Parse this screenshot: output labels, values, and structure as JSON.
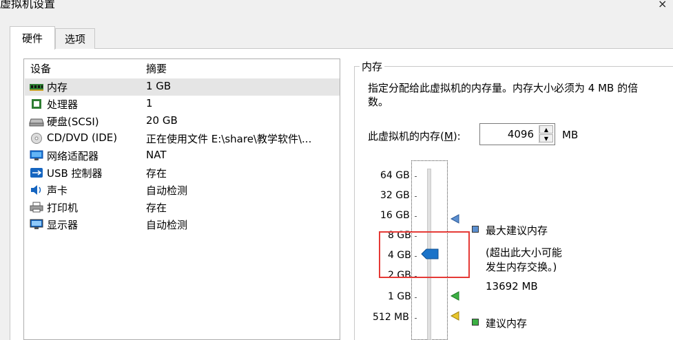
{
  "window": {
    "title": "虚拟机设置",
    "close_glyph": "×"
  },
  "tabs": [
    {
      "label": "硬件"
    },
    {
      "label": "选项"
    }
  ],
  "device_list": {
    "header_device": "设备",
    "header_summary": "摘要",
    "rows": [
      {
        "name": "内存",
        "summary": "1 GB",
        "icon": "memory-icon",
        "selected": true
      },
      {
        "name": "处理器",
        "summary": "1",
        "icon": "processor-icon"
      },
      {
        "name": "硬盘(SCSI)",
        "summary": "20 GB",
        "icon": "hard-disk-icon"
      },
      {
        "name": "CD/DVD (IDE)",
        "summary": "正在使用文件 E:\\share\\教学软件\\...",
        "icon": "cd-dvd-icon"
      },
      {
        "name": "网络适配器",
        "summary": "NAT",
        "icon": "network-adapter-icon"
      },
      {
        "name": "USB 控制器",
        "summary": "存在",
        "icon": "usb-icon"
      },
      {
        "name": "声卡",
        "summary": "自动检测",
        "icon": "speaker-icon"
      },
      {
        "name": "打印机",
        "summary": "存在",
        "icon": "printer-icon"
      },
      {
        "name": "显示器",
        "summary": "自动检测",
        "icon": "monitor-icon"
      }
    ]
  },
  "memory": {
    "group_label": "内存",
    "description": "指定分配给此虚拟机的内存量。内存大小必须为 4 MB 的倍数。",
    "field_label_prefix": "此虚拟机的内存(",
    "field_label_accel": "M",
    "field_label_suffix": "):",
    "value": "4096",
    "unit": "MB",
    "slider_labels": [
      "64 GB",
      "32 GB",
      "16 GB",
      "8 GB",
      "4 GB",
      "2 GB",
      "1 GB",
      "512 MB"
    ],
    "max_recommended_label": "最大建议内存",
    "max_recommended_note_1": "(超出此大小可能",
    "max_recommended_note_2": "发生内存交换。)",
    "max_recommended_value": "13692 MB",
    "recommended_label": "建议内存",
    "colors": {
      "max_marker": "#5b8fd0",
      "recommended_marker": "#3cb043",
      "guest_marker": "#e8c62a",
      "thumb": "#1a73c9",
      "highlight": "#e53935"
    }
  }
}
